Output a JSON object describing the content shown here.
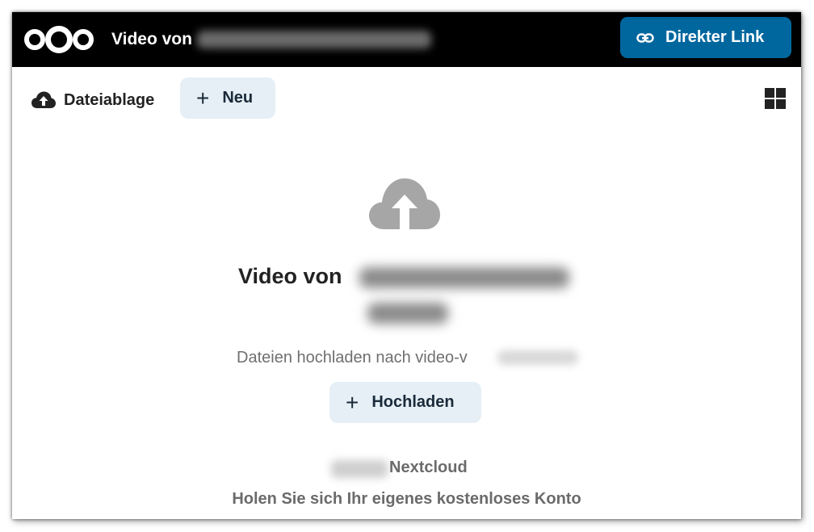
{
  "header": {
    "title_prefix": "Video von",
    "direct_link_label": "Direkter Link",
    "logo_icon": "nextcloud-logo-icon",
    "link_icon": "link-icon"
  },
  "toolbar": {
    "breadcrumb_label": "Dateiablage",
    "breadcrumb_icon": "cloud-upload-icon",
    "new_label": "Neu",
    "view_toggle_icon": "grid-view-icon"
  },
  "empty_state": {
    "icon": "cloud-upload-icon",
    "title_prefix": "Video von",
    "description": "Dateien hochladen nach video-v",
    "upload_label": "Hochladen"
  },
  "footer": {
    "brand": "Nextcloud",
    "signup_link": "Holen Sie sich Ihr eigenes kostenloses Konto"
  },
  "colors": {
    "header_bg": "#000000",
    "primary_button": "#00679e",
    "secondary_button": "#e5eff5",
    "icon_gray": "#a6a6a6"
  }
}
